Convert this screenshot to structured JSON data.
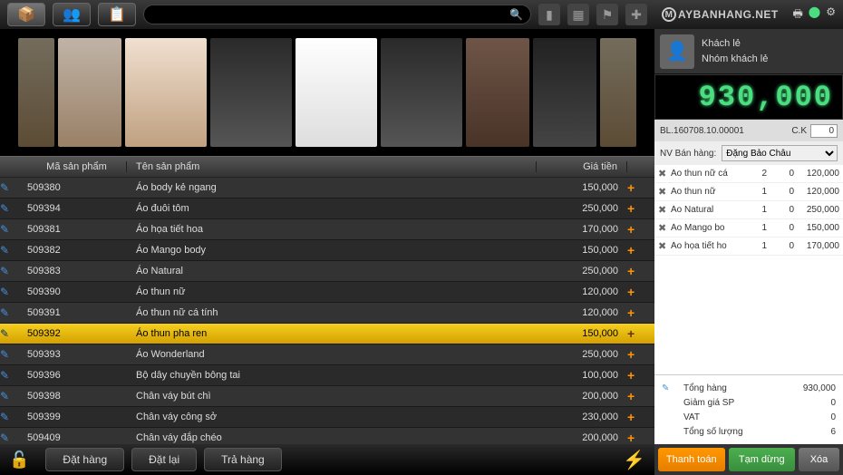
{
  "brand": "AYBANHANG.NET",
  "customer": {
    "name": "Khách lẻ",
    "group": "Nhóm khách lẻ"
  },
  "total": "930,000",
  "receipt_no": "BL.160708.10.00001",
  "ck_label": "C.K",
  "ck_value": "0",
  "seller_label": "NV Bán hàng:",
  "seller_name": "Đặng Bảo Châu",
  "headers": {
    "code": "Mã sản phẩm",
    "name": "Tên sản phẩm",
    "price": "Giá tiền"
  },
  "products": [
    {
      "code": "509380",
      "name": "Áo body kẻ ngang",
      "price": "150,000"
    },
    {
      "code": "509394",
      "name": "Áo đuôi tôm",
      "price": "250,000"
    },
    {
      "code": "509381",
      "name": "Áo họa tiết hoa",
      "price": "170,000"
    },
    {
      "code": "509382",
      "name": "Áo Mango body",
      "price": "150,000"
    },
    {
      "code": "509383",
      "name": "Áo Natural",
      "price": "250,000"
    },
    {
      "code": "509390",
      "name": "Áo thun nữ",
      "price": "120,000"
    },
    {
      "code": "509391",
      "name": "Áo thun nữ cá tính",
      "price": "120,000"
    },
    {
      "code": "509392",
      "name": "Áo thun pha ren",
      "price": "150,000",
      "selected": true
    },
    {
      "code": "509393",
      "name": "Áo Wonderland",
      "price": "250,000"
    },
    {
      "code": "509396",
      "name": "Bộ dây chuyền bông tai",
      "price": "100,000"
    },
    {
      "code": "509398",
      "name": "Chân váy bút chì",
      "price": "200,000"
    },
    {
      "code": "509399",
      "name": "Chân váy công sở",
      "price": "230,000"
    },
    {
      "code": "509409",
      "name": "Chân váy đắp chéo",
      "price": "200,000"
    }
  ],
  "cart": [
    {
      "name": "Áo thun nữ cá",
      "qty": "2",
      "disc": "0",
      "price": "120,000"
    },
    {
      "name": "Áo thun nữ",
      "qty": "1",
      "disc": "0",
      "price": "120,000"
    },
    {
      "name": "Áo Natural",
      "qty": "1",
      "disc": "0",
      "price": "250,000"
    },
    {
      "name": "Áo Mango bo",
      "qty": "1",
      "disc": "0",
      "price": "150,000"
    },
    {
      "name": "Áo họa tiết ho",
      "qty": "1",
      "disc": "0",
      "price": "170,000"
    }
  ],
  "summary": {
    "total_label": "Tổng hàng",
    "total_value": "930,000",
    "discount_label": "Giảm giá SP",
    "discount_value": "0",
    "vat_label": "VAT",
    "vat_value": "0",
    "qty_label": "Tổng số lượng",
    "qty_value": "6"
  },
  "actions": {
    "pay": "Thanh toán",
    "pause": "Tạm dừng",
    "delete": "Xóa"
  },
  "bottom": {
    "order": "Đặt hàng",
    "reset": "Đặt lại",
    "return": "Trả hàng"
  }
}
